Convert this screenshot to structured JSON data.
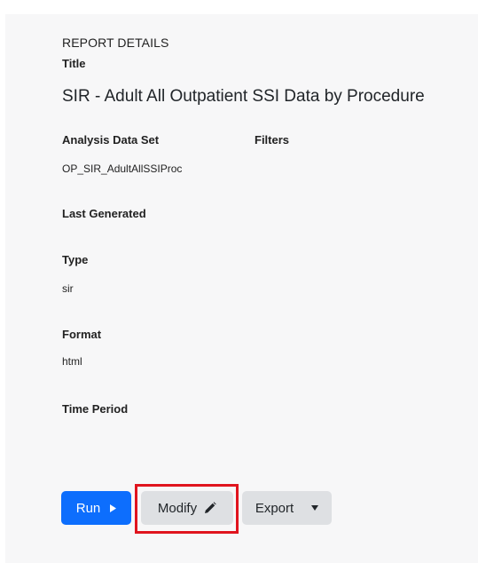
{
  "report": {
    "section_heading": "REPORT DETAILS",
    "title_label": "Title",
    "title_value": "SIR - Adult All Outpatient SSI Data by Procedure",
    "analysis_label": "Analysis Data Set",
    "analysis_value": "OP_SIR_AdultAllSSIProc",
    "filters_label": "Filters",
    "last_generated_label": "Last Generated",
    "type_label": "Type",
    "type_value": "sir",
    "format_label": "Format",
    "format_value": "html",
    "time_period_label": "Time Period"
  },
  "actions": {
    "run_label": "Run",
    "modify_label": "Modify",
    "export_label": "Export"
  },
  "icons": {
    "run": "caret-right-icon",
    "modify": "pencil-icon",
    "export": "caret-down-icon"
  },
  "colors": {
    "primary": "#0d6efd",
    "secondary": "#dee0e3",
    "highlight": "#e0141e",
    "panel": "#f7f7f8"
  }
}
